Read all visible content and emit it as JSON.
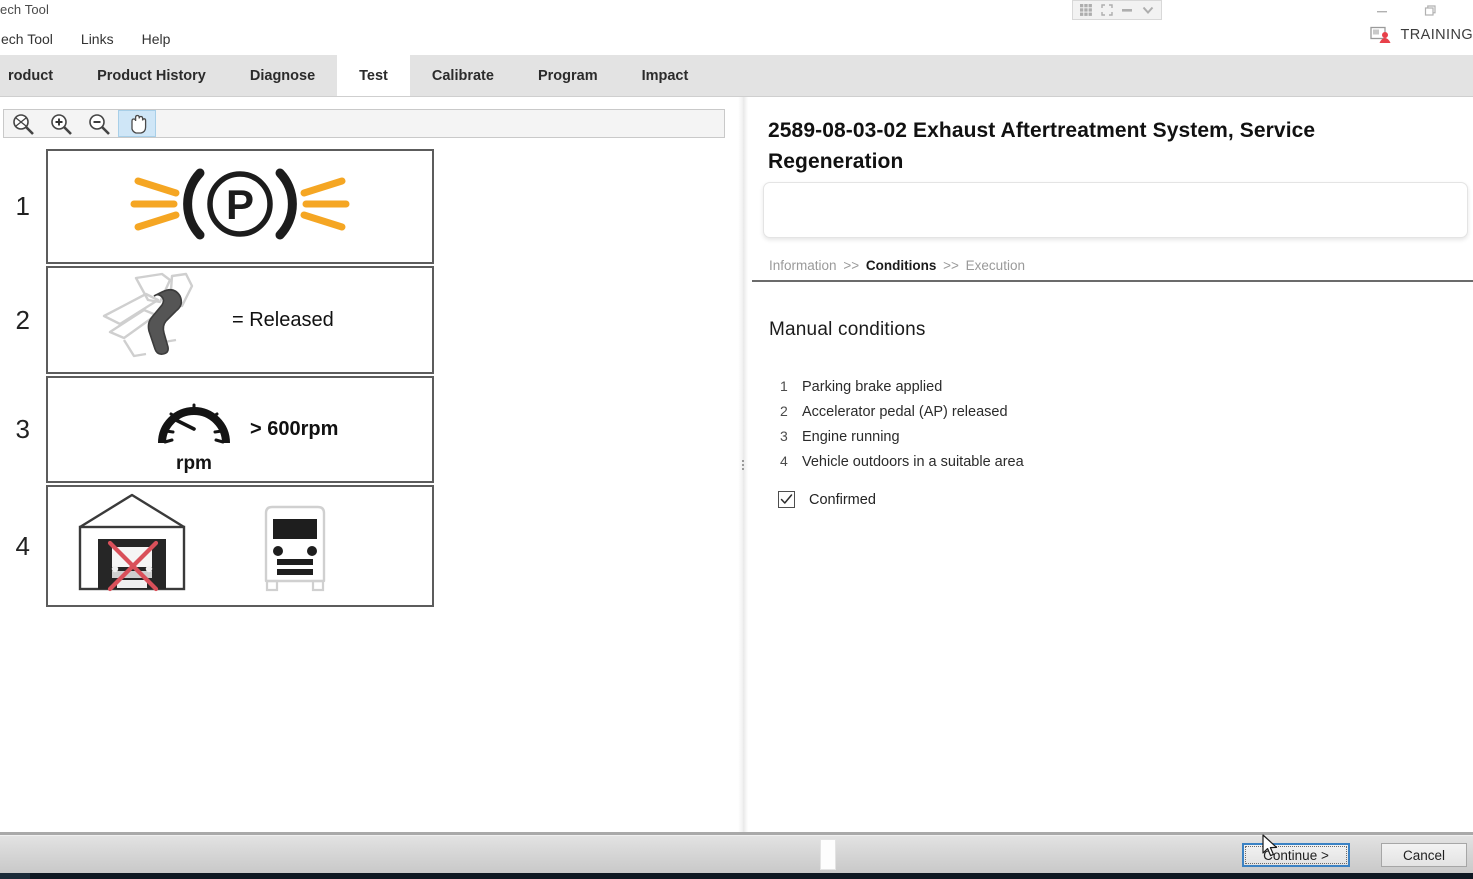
{
  "window": {
    "title": "ech Tool",
    "minimize_icon": "minimize-icon",
    "restore_icon": "restore-icon"
  },
  "floating_toolbar": {
    "items": [
      {
        "name": "grid-icon"
      },
      {
        "name": "expand-icon"
      },
      {
        "name": "minimize-dash-icon"
      },
      {
        "name": "chevron-down-icon"
      }
    ]
  },
  "menu": {
    "items": [
      {
        "label": "ech Tool"
      },
      {
        "label": "Links"
      },
      {
        "label": "Help"
      }
    ],
    "training_label": "TRAINING",
    "training_icon": "training-user-icon"
  },
  "tabs": [
    {
      "label": "roduct",
      "active": false
    },
    {
      "label": "Product History",
      "active": false
    },
    {
      "label": "Diagnose",
      "active": false
    },
    {
      "label": "Test",
      "active": true
    },
    {
      "label": "Calibrate",
      "active": false
    },
    {
      "label": "Program",
      "active": false
    },
    {
      "label": "Impact",
      "active": false
    }
  ],
  "image_toolbar": {
    "tools": [
      {
        "name": "zoom-fit-icon",
        "selected": false
      },
      {
        "name": "zoom-in-icon",
        "selected": false
      },
      {
        "name": "zoom-out-icon",
        "selected": false
      },
      {
        "name": "pan-hand-icon",
        "selected": true
      }
    ]
  },
  "illustrations": [
    {
      "number": "1",
      "icon": "parking-brake-warning-icon",
      "label": ""
    },
    {
      "number": "2",
      "icon": "accelerator-pedal-icon",
      "label": "= Released"
    },
    {
      "number": "3",
      "icon": "tachometer-icon",
      "gauge_unit": "rpm",
      "label": "> 600rpm"
    },
    {
      "number": "4",
      "icon": "garage-no-truck-outdoors-truck-icon",
      "label": ""
    }
  ],
  "document": {
    "title": "2589-08-03-02 Exhaust Aftertreatment System, Service Regeneration",
    "note_box_text": "",
    "breadcrumb": [
      {
        "label": "Information",
        "current": false
      },
      {
        "label": "Conditions",
        "current": true
      },
      {
        "label": "Execution",
        "current": false
      }
    ],
    "breadcrumb_separator": ">>",
    "section_heading": "Manual conditions",
    "conditions": [
      {
        "number": "1",
        "text": "Parking brake applied"
      },
      {
        "number": "2",
        "text": "Accelerator pedal (AP) released"
      },
      {
        "number": "3",
        "text": "Engine running"
      },
      {
        "number": "4",
        "text": "Vehicle outdoors in a suitable area"
      }
    ],
    "confirm": {
      "label": "Confirmed",
      "checked": true,
      "check_icon": "checkmark-icon"
    }
  },
  "footer": {
    "continue_label": "Continue >",
    "cancel_label": "Cancel"
  },
  "colors": {
    "accent_orange": "#F5A623",
    "focus_blue": "#3B82C4",
    "tab_bar": "#E3E3E3",
    "red_cross": "#D9505A"
  }
}
